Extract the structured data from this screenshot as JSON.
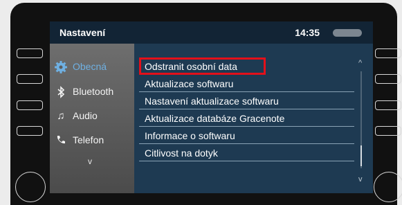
{
  "header": {
    "title": "Nastavení",
    "time": "14:35"
  },
  "sidebar": {
    "items": [
      {
        "label": "Obecná",
        "icon": "gear-icon",
        "active": true
      },
      {
        "label": "Bluetooth",
        "icon": "bluetooth-icon"
      },
      {
        "label": "Audio",
        "icon": "music-note-icon"
      },
      {
        "label": "Telefon",
        "icon": "phone-icon"
      }
    ],
    "more": "v"
  },
  "list": {
    "items": [
      "Odstranit osobní data",
      "Aktualizace softwaru",
      "Nastavení aktualizace softwaru",
      "Aktualizace databáze Gracenote",
      "Informace o softwaru",
      "Citlivost na dotyk"
    ]
  },
  "scrollbar": {
    "up": "^",
    "down": "v"
  },
  "colors": {
    "highlight": "#e3101a",
    "active_text": "#6fb0e2",
    "screen_bg": "#1e3a52"
  }
}
